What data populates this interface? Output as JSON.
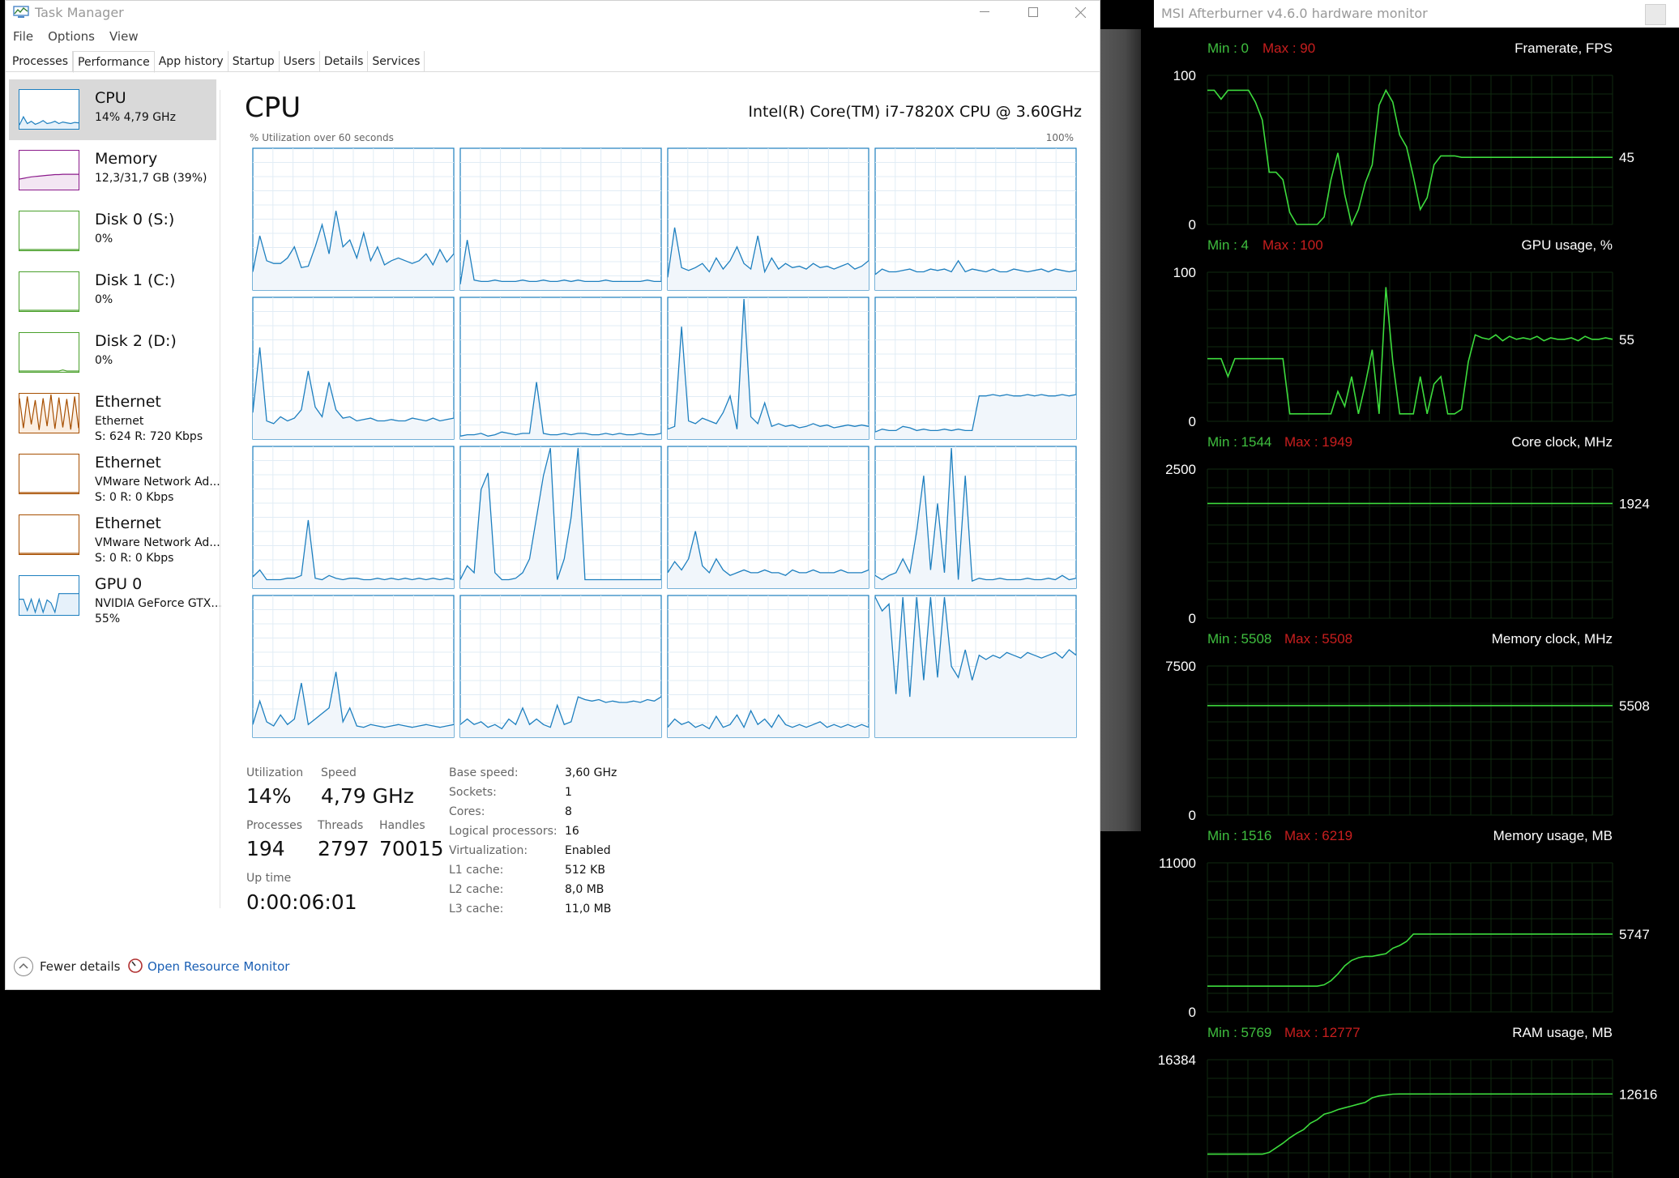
{
  "task_manager": {
    "title": "Task Manager",
    "menu": [
      "File",
      "Options",
      "View"
    ],
    "tabs": [
      "Processes",
      "Performance",
      "App history",
      "Startup",
      "Users",
      "Details",
      "Services"
    ],
    "active_tab": "Performance",
    "sidebar": [
      {
        "name": "CPU",
        "sub1": "14% 4,79 GHz",
        "sub2": "",
        "color": "#1d7fbf",
        "fill": "#e6f1fa"
      },
      {
        "name": "Memory",
        "sub1": "12,3/31,7 GB (39%)",
        "sub2": "",
        "color": "#8b1a8b",
        "fill": "#f3e6f3"
      },
      {
        "name": "Disk 0 (S:)",
        "sub1": "0%",
        "sub2": "",
        "color": "#4aa02c",
        "fill": "#eef7ea"
      },
      {
        "name": "Disk 1 (C:)",
        "sub1": "0%",
        "sub2": "",
        "color": "#4aa02c",
        "fill": "#eef7ea"
      },
      {
        "name": "Disk 2 (D:)",
        "sub1": "0%",
        "sub2": "",
        "color": "#4aa02c",
        "fill": "#eef7ea"
      },
      {
        "name": "Ethernet",
        "sub1": "Ethernet",
        "sub2": "S: 624 R: 720 Kbps",
        "color": "#a74f01",
        "fill": "#fbeee1"
      },
      {
        "name": "Ethernet",
        "sub1": "VMware Network Ad...",
        "sub2": "S: 0 R: 0 Kbps",
        "color": "#a74f01",
        "fill": "#fbeee1"
      },
      {
        "name": "Ethernet",
        "sub1": "VMware Network Ad...",
        "sub2": "S: 0 R: 0 Kbps",
        "color": "#a74f01",
        "fill": "#fbeee1"
      },
      {
        "name": "GPU 0",
        "sub1": "NVIDIA GeForce GTX...",
        "sub2": "55%",
        "color": "#1d7fbf",
        "fill": "#e6f1fa"
      }
    ],
    "cpu": {
      "heading": "CPU",
      "model": "Intel(R) Core(TM) i7-7820X CPU @ 3.60GHz",
      "graph_label": "% Utilization over 60 seconds",
      "graph_max": "100%",
      "utilization_label": "Utilization",
      "utilization": "14%",
      "speed_label": "Speed",
      "speed": "4,79 GHz",
      "processes_label": "Processes",
      "processes": "194",
      "threads_label": "Threads",
      "threads": "2797",
      "handles_label": "Handles",
      "handles": "70015",
      "uptime_label": "Up time",
      "uptime": "0:00:06:01",
      "specs": [
        {
          "label": "Base speed:",
          "value": "3,60 GHz"
        },
        {
          "label": "Sockets:",
          "value": "1"
        },
        {
          "label": "Cores:",
          "value": "8"
        },
        {
          "label": "Logical processors:",
          "value": "16"
        },
        {
          "label": "Virtualization:",
          "value": "Enabled"
        },
        {
          "label": "L1 cache:",
          "value": "512 KB"
        },
        {
          "label": "L2 cache:",
          "value": "8,0 MB"
        },
        {
          "label": "L3 cache:",
          "value": "11,0 MB"
        }
      ],
      "core_graph_color": "#1d7fbf",
      "core_graphs": [
        [
          12,
          38,
          20,
          18,
          18,
          22,
          30,
          15,
          16,
          30,
          46,
          25,
          56,
          30,
          35,
          22,
          40,
          20,
          30,
          17,
          20,
          22,
          20,
          18,
          20,
          25,
          17,
          28,
          19,
          25
        ],
        [
          3,
          35,
          6,
          5,
          5,
          6,
          5,
          5,
          5,
          6,
          5,
          5,
          6,
          5,
          5,
          6,
          5,
          6,
          5,
          5,
          5,
          6,
          5,
          5,
          5,
          5,
          5,
          6,
          5,
          5
        ],
        [
          8,
          44,
          15,
          13,
          15,
          18,
          12,
          22,
          14,
          20,
          30,
          18,
          14,
          38,
          12,
          22,
          14,
          18,
          15,
          16,
          14,
          18,
          15,
          16,
          14,
          16,
          18,
          14,
          16,
          20
        ],
        [
          10,
          14,
          12,
          12,
          13,
          14,
          12,
          12,
          14,
          13,
          14,
          12,
          20,
          12,
          14,
          13,
          12,
          14,
          12,
          12,
          14,
          13,
          12,
          13,
          14,
          12,
          14,
          13,
          12,
          13
        ],
        [
          18,
          65,
          12,
          10,
          15,
          12,
          14,
          20,
          48,
          22,
          15,
          40,
          20,
          14,
          15,
          12,
          13,
          14,
          12,
          12,
          13,
          12,
          12,
          14,
          13,
          12,
          14,
          12,
          13,
          14
        ],
        [
          1,
          2,
          2,
          3,
          1,
          2,
          4,
          3,
          2,
          3,
          3,
          40,
          3,
          2,
          2,
          3,
          2,
          3,
          3,
          2,
          2,
          3,
          2,
          3,
          2,
          2,
          3,
          2,
          2,
          3
        ],
        [
          6,
          8,
          80,
          12,
          10,
          14,
          12,
          10,
          18,
          30,
          6,
          100,
          15,
          10,
          25,
          8,
          10,
          8,
          9,
          7,
          8,
          10,
          8,
          9,
          7,
          8,
          9,
          8,
          9,
          8
        ],
        [
          4,
          6,
          5,
          5,
          8,
          7,
          5,
          6,
          5,
          5,
          6,
          5,
          6,
          5,
          5,
          30,
          30,
          31,
          30,
          31,
          30,
          30,
          31,
          30,
          31,
          30,
          30,
          31,
          30,
          31
        ],
        [
          7,
          12,
          5,
          5,
          5,
          6,
          6,
          8,
          48,
          6,
          5,
          8,
          6,
          5,
          6,
          6,
          5,
          5,
          6,
          5,
          6,
          5,
          6,
          5,
          6,
          5,
          6,
          5,
          6,
          5
        ],
        [
          5,
          15,
          10,
          70,
          82,
          10,
          5,
          5,
          6,
          10,
          20,
          50,
          80,
          100,
          5,
          20,
          50,
          100,
          5,
          5,
          5,
          5,
          5,
          5,
          5,
          5,
          5,
          5,
          5,
          5
        ],
        [
          10,
          18,
          12,
          20,
          40,
          15,
          10,
          20,
          12,
          8,
          10,
          12,
          10,
          10,
          12,
          10,
          10,
          8,
          12,
          10,
          10,
          12,
          10,
          10,
          10,
          12,
          10,
          10,
          10,
          12
        ],
        [
          8,
          5,
          8,
          10,
          20,
          10,
          40,
          80,
          12,
          60,
          10,
          100,
          5,
          80,
          4,
          6,
          5,
          5,
          6,
          5,
          5,
          5,
          6,
          5,
          5,
          6,
          5,
          8,
          5,
          6
        ],
        [
          8,
          25,
          10,
          7,
          15,
          8,
          12,
          38,
          8,
          12,
          16,
          20,
          46,
          10,
          20,
          7,
          6,
          8,
          7,
          6,
          7,
          8,
          7,
          6,
          7,
          8,
          7,
          6,
          7,
          8
        ],
        [
          8,
          12,
          8,
          10,
          6,
          8,
          5,
          12,
          8,
          20,
          8,
          12,
          8,
          6,
          22,
          8,
          10,
          28,
          26,
          25,
          26,
          24,
          25,
          24,
          24,
          25,
          24,
          26,
          25,
          28
        ],
        [
          6,
          12,
          8,
          10,
          6,
          8,
          5,
          14,
          6,
          8,
          15,
          6,
          18,
          8,
          12,
          6,
          15,
          8,
          6,
          8,
          6,
          8,
          10,
          6,
          8,
          6,
          8,
          6,
          8,
          6
        ],
        [
          100,
          90,
          95,
          30,
          100,
          28,
          100,
          40,
          100,
          42,
          100,
          50,
          42,
          62,
          40,
          58,
          55,
          58,
          56,
          60,
          58,
          56,
          60,
          58,
          56,
          58,
          60,
          56,
          62,
          58
        ]
      ]
    },
    "footer": {
      "fewer": "Fewer details",
      "resource_monitor": "Open Resource Monitor"
    }
  },
  "afterburner": {
    "title": "MSI Afterburner v4.6.0 hardware monitor",
    "min_color": "#3fbf3f",
    "max_color": "#c81e1e",
    "line_color": "#3ddb3d",
    "graphs": [
      {
        "label": "Framerate, FPS",
        "min": "Min : 0",
        "max": "Max : 90",
        "top": "100",
        "bottom": "0",
        "current": "45",
        "series": [
          90,
          90,
          84,
          90,
          90,
          90,
          90,
          82,
          70,
          35,
          35,
          30,
          8,
          0,
          0,
          0,
          0,
          5,
          30,
          48,
          20,
          0,
          10,
          28,
          40,
          80,
          90,
          82,
          60,
          52,
          32,
          10,
          18,
          40,
          46,
          46,
          46,
          45,
          45,
          45,
          45,
          45,
          45,
          45,
          45,
          45,
          45,
          45,
          45,
          45,
          45,
          45,
          45,
          45,
          45,
          45,
          45,
          45,
          45,
          45
        ]
      },
      {
        "label": "GPU usage, %",
        "min": "Min : 4",
        "max": "Max : 100",
        "top": "100",
        "bottom": "0",
        "current": "55",
        "series": [
          42,
          42,
          42,
          30,
          42,
          42,
          42,
          42,
          42,
          42,
          42,
          42,
          5,
          5,
          5,
          5,
          5,
          5,
          5,
          20,
          10,
          30,
          5,
          25,
          48,
          5,
          90,
          40,
          5,
          5,
          5,
          30,
          5,
          25,
          30,
          5,
          5,
          8,
          40,
          58,
          56,
          55,
          58,
          54,
          57,
          55,
          56,
          55,
          57,
          54,
          56,
          55,
          55,
          56,
          54,
          57,
          55,
          55,
          56,
          55
        ]
      },
      {
        "label": "Core clock, MHz",
        "min": "Min : 1544",
        "max": "Max : 1949",
        "top": "2500",
        "bottom": "0",
        "current": "1924",
        "series": [
          1924,
          1924,
          1924,
          1924,
          1924,
          1924,
          1924,
          1924,
          1924,
          1924,
          1924,
          1924,
          1924,
          1924,
          1924,
          1924,
          1924,
          1924,
          1924,
          1924,
          1924,
          1924,
          1924,
          1924,
          1924,
          1924,
          1924,
          1924,
          1924,
          1924
        ]
      },
      {
        "label": "Memory clock, MHz",
        "min": "Min : 5508",
        "max": "Max : 5508",
        "top": "7500",
        "bottom": "0",
        "current": "5508",
        "series": [
          5508,
          5508,
          5508,
          5508,
          5508,
          5508,
          5508,
          5508,
          5508,
          5508,
          5508,
          5508,
          5508,
          5508,
          5508,
          5508,
          5508,
          5508,
          5508,
          5508,
          5508,
          5508,
          5508,
          5508,
          5508,
          5508,
          5508,
          5508,
          5508,
          5508
        ]
      },
      {
        "label": "Memory usage, MB",
        "min": "Min : 1516",
        "max": "Max : 6219",
        "top": "11000",
        "bottom": "0",
        "current": "5747",
        "series": [
          1900,
          1900,
          1900,
          1900,
          1900,
          1900,
          1900,
          1900,
          1900,
          1900,
          1900,
          1900,
          1900,
          1900,
          1900,
          1900,
          1900,
          2000,
          2300,
          2800,
          3400,
          3800,
          4000,
          4100,
          4100,
          4200,
          4300,
          4700,
          4900,
          5200,
          5747,
          5747,
          5747,
          5747,
          5747,
          5747,
          5747,
          5747,
          5747,
          5747,
          5747,
          5747,
          5747,
          5747,
          5747,
          5747,
          5747,
          5747,
          5747,
          5747,
          5747,
          5747,
          5747,
          5747,
          5747,
          5747,
          5747,
          5747,
          5747,
          5747
        ]
      },
      {
        "label": "RAM usage, MB",
        "min": "Min : 5769",
        "max": "Max : 12777",
        "top": "16384",
        "bottom": "",
        "current": "12616",
        "series": [
          6000,
          6000,
          6000,
          6000,
          6000,
          6000,
          6000,
          6000,
          6000,
          6200,
          6700,
          7200,
          7800,
          8300,
          8700,
          9400,
          9800,
          10400,
          10600,
          10900,
          11100,
          11300,
          11500,
          11700,
          12200,
          12400,
          12500,
          12600,
          12616,
          12616,
          12616,
          12616,
          12616,
          12616,
          12616,
          12616,
          12616,
          12616,
          12616,
          12616,
          12616,
          12616,
          12616,
          12616,
          12616,
          12616,
          12616,
          12616,
          12616,
          12616,
          12616,
          12616,
          12616,
          12616,
          12616,
          12616,
          12616,
          12616,
          12616,
          12616
        ]
      }
    ]
  }
}
